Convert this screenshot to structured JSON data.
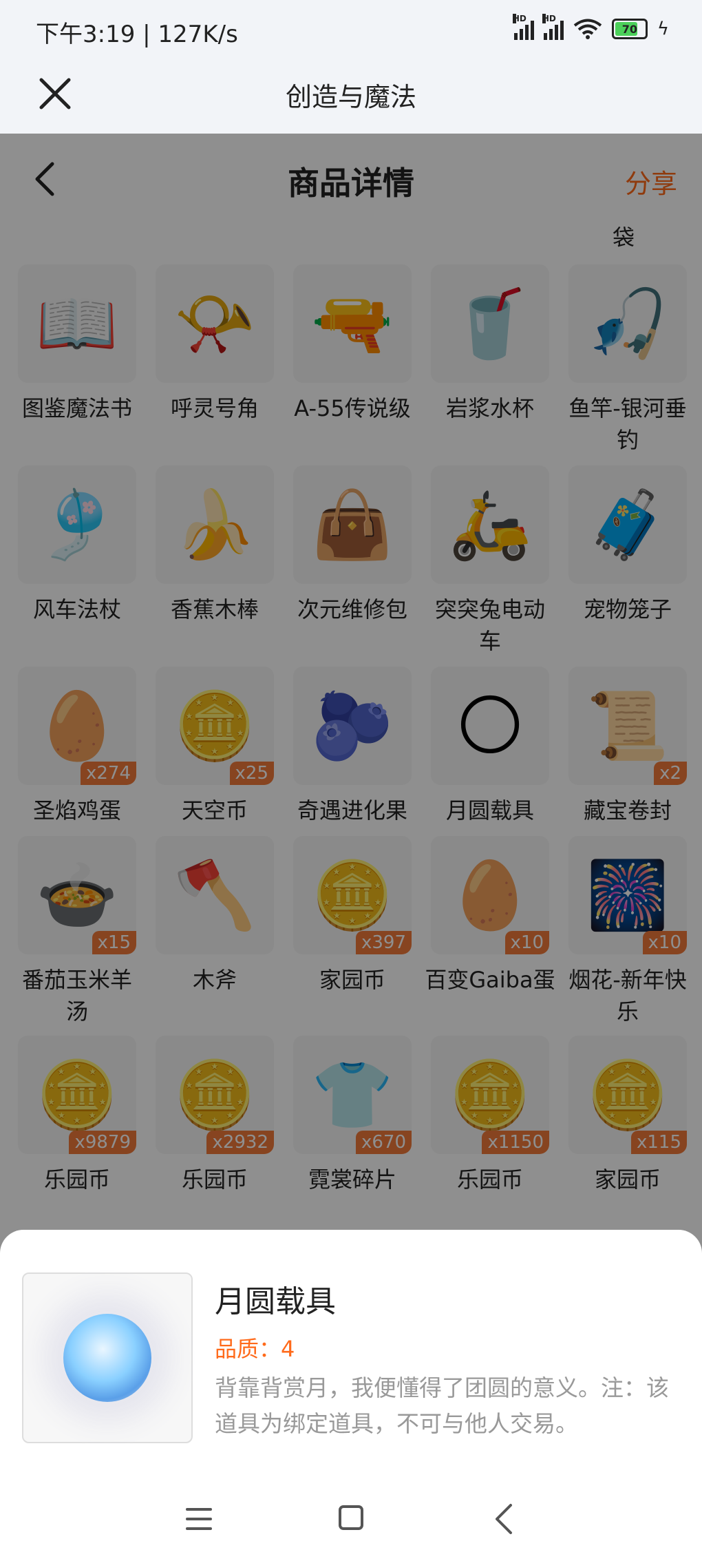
{
  "status": {
    "time": "下午3:19 | 127K/s",
    "battery": "70",
    "hd": "HD"
  },
  "webview": {
    "title": "创造与魔法"
  },
  "page": {
    "title": "商品详情",
    "share_label": "分享",
    "bag_label": "袋"
  },
  "items": [
    {
      "name": "图鉴魔法书",
      "icon": "book-icon",
      "glyph": "📖",
      "count": ""
    },
    {
      "name": "呼灵号角",
      "icon": "horn-icon",
      "glyph": "📯",
      "count": ""
    },
    {
      "name": "A-55传说级",
      "icon": "rifle-icon",
      "glyph": "🔫",
      "count": ""
    },
    {
      "name": "岩浆水杯",
      "icon": "cup-icon",
      "glyph": "🥤",
      "count": ""
    },
    {
      "name": "鱼竿-银河垂钓",
      "icon": "fishing-rod-icon",
      "glyph": "🎣",
      "count": ""
    },
    {
      "name": "风车法杖",
      "icon": "pinwheel-icon",
      "glyph": "🎐",
      "count": ""
    },
    {
      "name": "香蕉木棒",
      "icon": "banana-icon",
      "glyph": "🍌",
      "count": ""
    },
    {
      "name": "次元维修包",
      "icon": "repair-bag-icon",
      "glyph": "👜",
      "count": ""
    },
    {
      "name": "突突兔电动车",
      "icon": "scooter-icon",
      "glyph": "🛵",
      "count": ""
    },
    {
      "name": "宠物笼子",
      "icon": "pet-cage-icon",
      "glyph": "🧳",
      "count": ""
    },
    {
      "name": "圣焰鸡蛋",
      "icon": "egg-icon",
      "glyph": "🥚",
      "count": "x274"
    },
    {
      "name": "天空币",
      "icon": "sky-coin-icon",
      "glyph": "🪙",
      "count": "x25"
    },
    {
      "name": "奇遇进化果",
      "icon": "fruit-icon",
      "glyph": "🫐",
      "count": ""
    },
    {
      "name": "月圆载具",
      "icon": "moon-vehicle-icon",
      "glyph": "🌕",
      "count": ""
    },
    {
      "name": "藏宝卷封",
      "icon": "scroll-icon",
      "glyph": "📜",
      "count": "x2"
    },
    {
      "name": "番茄玉米羊汤",
      "icon": "soup-icon",
      "glyph": "🍲",
      "count": "x15"
    },
    {
      "name": "木斧",
      "icon": "axe-icon",
      "glyph": "🪓",
      "count": ""
    },
    {
      "name": "家园币",
      "icon": "home-coin-icon",
      "glyph": "🪙",
      "count": "x397"
    },
    {
      "name": "百变Gaiba蛋",
      "icon": "gaiba-egg-icon",
      "glyph": "🥚",
      "count": "x10"
    },
    {
      "name": "烟花-新年快乐",
      "icon": "firework-icon",
      "glyph": "🎆",
      "count": "x10"
    },
    {
      "name": "乐园币",
      "icon": "park-coin-icon",
      "glyph": "🪙",
      "count": "x9879"
    },
    {
      "name": "乐园币",
      "icon": "park-coin-icon",
      "glyph": "🪙",
      "count": "x2932"
    },
    {
      "name": "霓裳碎片",
      "icon": "shirt-fragment-icon",
      "glyph": "👕",
      "count": "x670"
    },
    {
      "name": "乐园币",
      "icon": "park-coin-icon",
      "glyph": "🪙",
      "count": "x1150"
    },
    {
      "name": "家园币",
      "icon": "home-coin-icon",
      "glyph": "🪙",
      "count": "x115"
    }
  ],
  "detail": {
    "name": "月圆载具",
    "quality": "品质：4",
    "description": "背靠背赏月，我便懂得了团圆的意义。注：该道具为绑定道具，不可与他人交易。"
  }
}
